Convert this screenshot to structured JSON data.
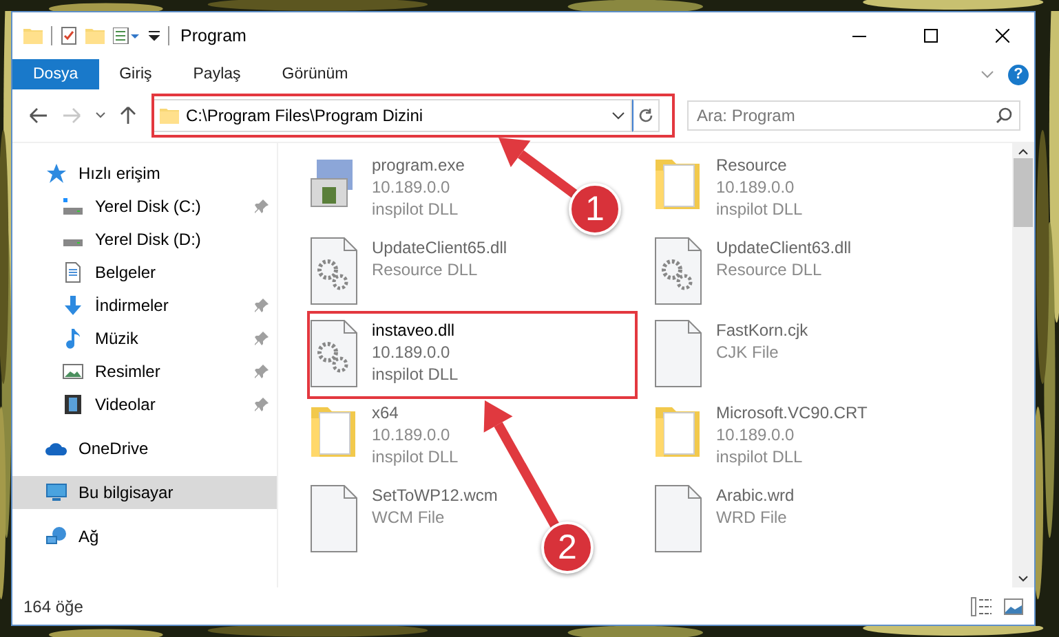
{
  "window": {
    "title": "Program"
  },
  "ribbon": {
    "tabs": [
      {
        "label": "Dosya",
        "selected": true
      },
      {
        "label": "Giriş",
        "selected": false
      },
      {
        "label": "Paylaş",
        "selected": false
      },
      {
        "label": "Görünüm",
        "selected": false
      }
    ],
    "help": "?"
  },
  "navigation": {
    "forward_disabled": true
  },
  "address_bar": {
    "path": "C:\\Program Files\\Program Dizini"
  },
  "search": {
    "placeholder": "Ara: Program"
  },
  "sidebar": {
    "items": [
      {
        "label": "Hızlı erişim",
        "kind": "star",
        "selected": false,
        "children": [
          {
            "label": "Yerel Disk (C:)",
            "kind": "drive-c",
            "pinned": true,
            "selected": false
          },
          {
            "label": "Yerel Disk (D:)",
            "kind": "drive",
            "pinned": false,
            "selected": false
          },
          {
            "label": "Belgeler",
            "kind": "documents",
            "pinned": false,
            "selected": false
          },
          {
            "label": "İndirmeler",
            "kind": "downloads",
            "pinned": true,
            "selected": false
          },
          {
            "label": "Müzik",
            "kind": "music",
            "pinned": true,
            "selected": false
          },
          {
            "label": "Resimler",
            "kind": "pictures",
            "pinned": true,
            "selected": false
          },
          {
            "label": "Videolar",
            "kind": "videos",
            "pinned": true,
            "selected": false
          }
        ]
      },
      {
        "label": "OneDrive",
        "kind": "cloud",
        "selected": false
      },
      {
        "label": "Bu bilgisayar",
        "kind": "computer",
        "selected": true
      },
      {
        "label": "Ağ",
        "kind": "network",
        "selected": false
      }
    ]
  },
  "files": [
    {
      "name": "program.exe",
      "kind": "exe",
      "details": [
        "10.189.0.0",
        "inspilot DLL"
      ],
      "blurred": true
    },
    {
      "name": "Resource",
      "kind": "folder",
      "details": [
        "10.189.0.0",
        "inspilot DLL"
      ],
      "blurred": true
    },
    {
      "name": "UpdateClient65.dll",
      "kind": "dll",
      "details": [
        "Resource DLL"
      ],
      "blurred": true
    },
    {
      "name": "UpdateClient63.dll",
      "kind": "dll",
      "details": [
        "Resource DLL"
      ],
      "blurred": true
    },
    {
      "name": "instaveo.dll",
      "kind": "dll",
      "details": [
        "10.189.0.0",
        "inspilot DLL"
      ],
      "blurred": false
    },
    {
      "name": "FastKorn.cjk",
      "kind": "file",
      "details": [
        "CJK File"
      ],
      "blurred": true
    },
    {
      "name": "x64",
      "kind": "folder",
      "details": [
        "10.189.0.0",
        "inspilot DLL"
      ],
      "blurred": true
    },
    {
      "name": "Microsoft.VC90.CRT",
      "kind": "folder",
      "details": [
        "10.189.0.0",
        "inspilot DLL"
      ],
      "blurred": true
    },
    {
      "name": "SetToWP12.wcm",
      "kind": "file",
      "details": [
        "WCM File"
      ],
      "blurred": true
    },
    {
      "name": "Arabic.wrd",
      "kind": "file",
      "details": [
        "WRD File"
      ],
      "blurred": true
    }
  ],
  "status_bar": {
    "count": "164 öğe"
  },
  "annotations": [
    {
      "number": "1"
    },
    {
      "number": "2"
    }
  ]
}
